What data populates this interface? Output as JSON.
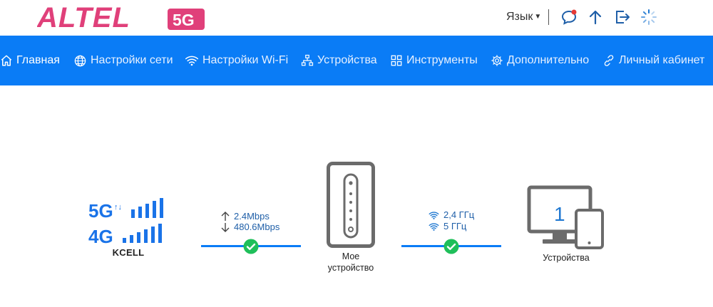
{
  "brand": {
    "name": "ALTEL",
    "badge": "5G",
    "color_primary": "#e0407a",
    "color_badge": "#e0407a"
  },
  "header": {
    "language_label": "Язык",
    "icons": [
      "message-icon",
      "upload-icon",
      "logout-icon",
      "loading-icon"
    ]
  },
  "nav": {
    "background": "#0a7cf6",
    "items": [
      {
        "label": "Главная",
        "icon": "home-icon"
      },
      {
        "label": "Настройки сети",
        "icon": "globe-icon"
      },
      {
        "label": "Настройки Wi-Fi",
        "icon": "wifi-icon"
      },
      {
        "label": "Устройства",
        "icon": "devices-icon"
      },
      {
        "label": "Инструменты",
        "icon": "tools-icon"
      },
      {
        "label": "Дополнительно",
        "icon": "gear-icon"
      },
      {
        "label": "Личный кабинет",
        "icon": "link-icon"
      }
    ]
  },
  "status": {
    "network": {
      "tech_top": "5G",
      "tech_bottom": "4G",
      "operator": "KCELL"
    },
    "traffic": {
      "upload": "2.4Mbps",
      "download": "480.6Mbps"
    },
    "router": {
      "label_line1": "Мое",
      "label_line2": "устройство"
    },
    "wifi": {
      "band1": "2,4 ГГц",
      "band2": "5 ГГц"
    },
    "clients": {
      "count": "1",
      "label": "Устройства"
    }
  }
}
